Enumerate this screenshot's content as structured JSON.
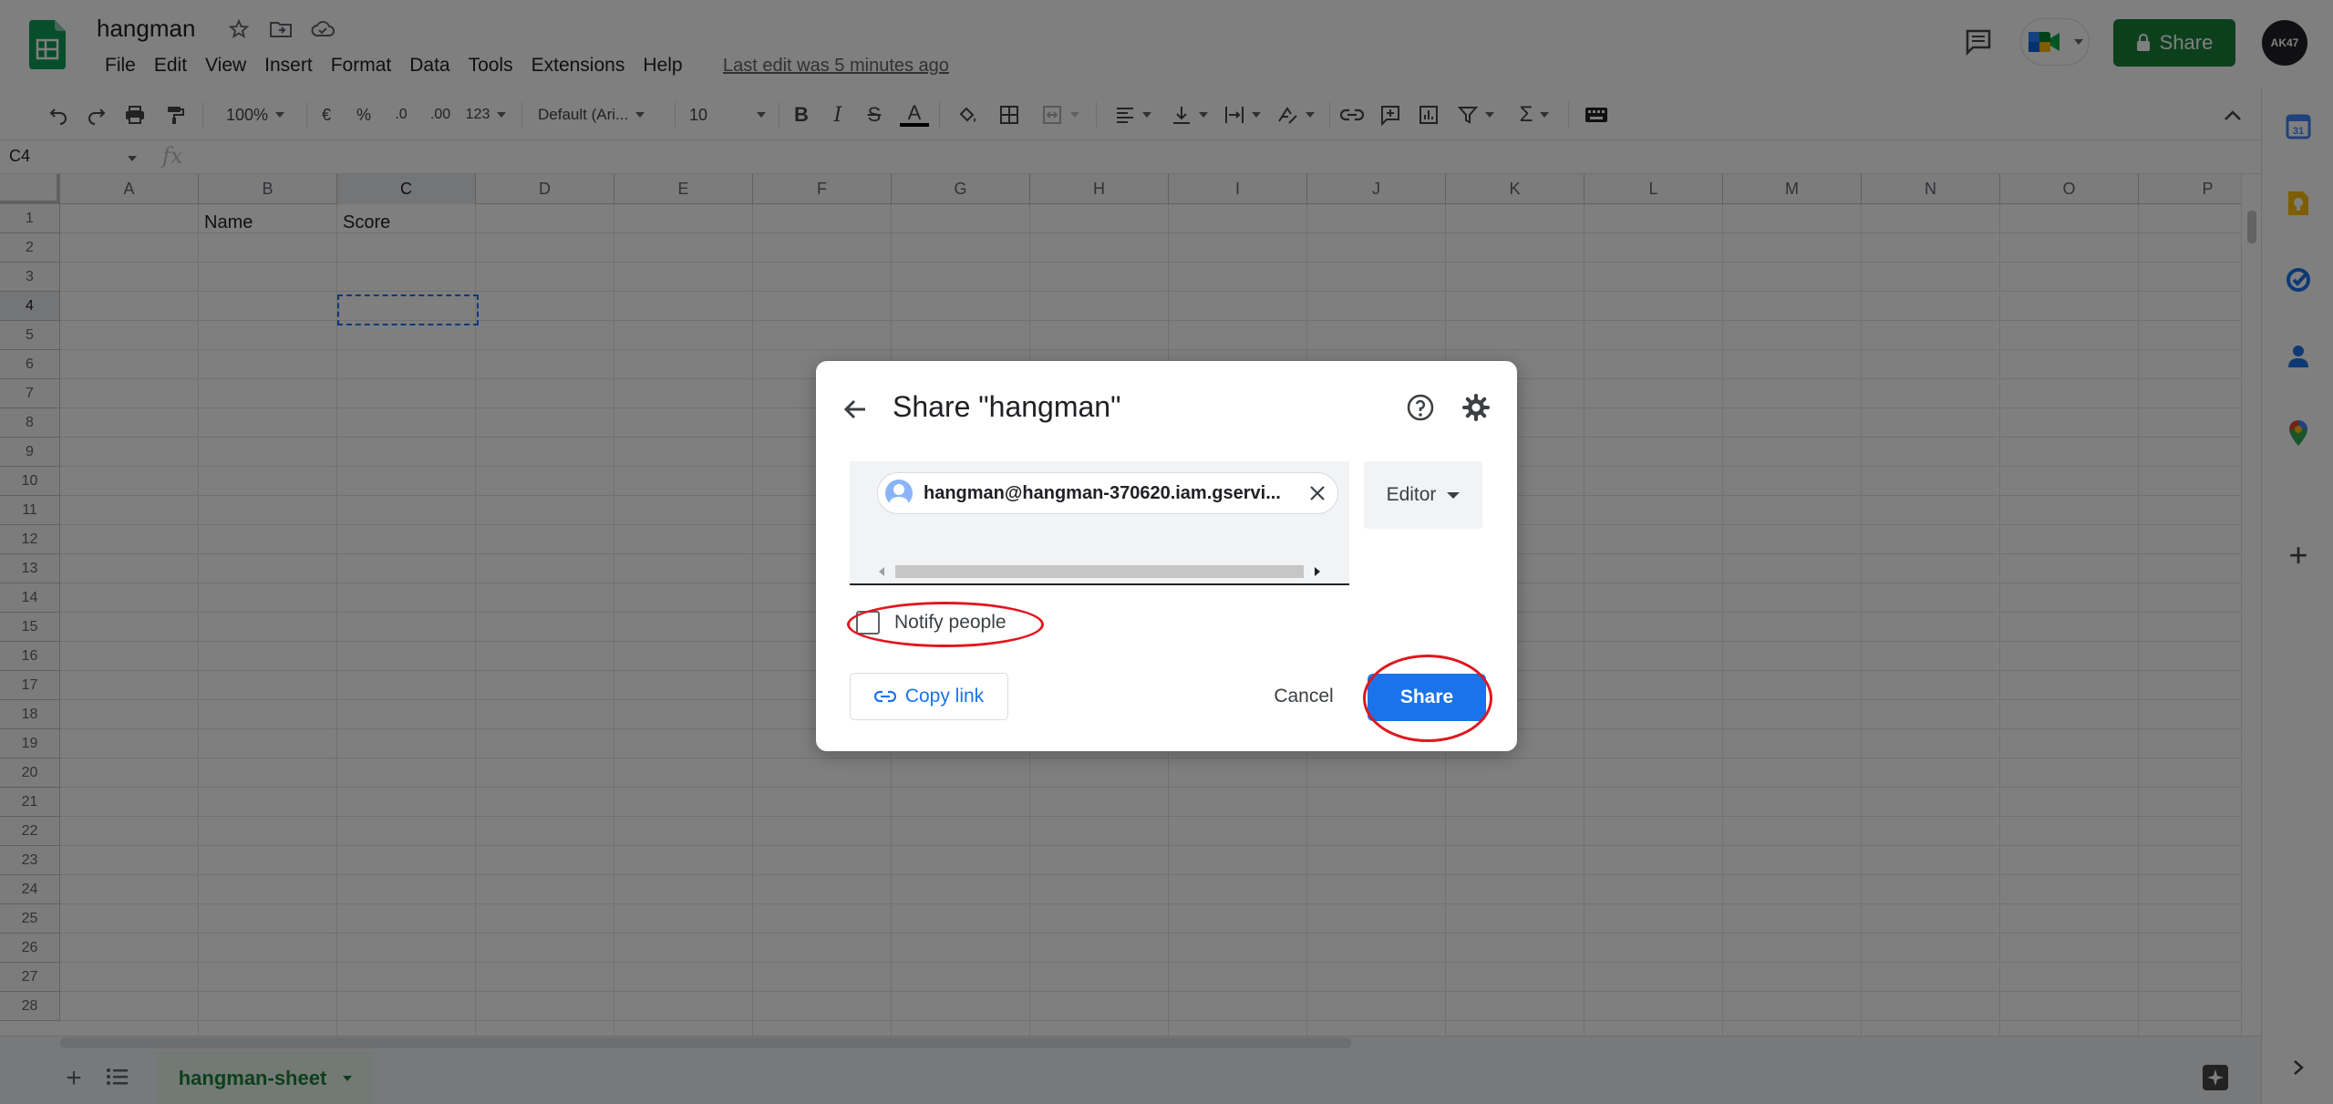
{
  "header": {
    "doc_title": "hangman",
    "menu": [
      "File",
      "Edit",
      "View",
      "Insert",
      "Format",
      "Data",
      "Tools",
      "Extensions",
      "Help"
    ],
    "last_edit": "Last edit was 5 minutes ago",
    "share_label": "Share",
    "avatar_text": "AK47"
  },
  "toolbar": {
    "zoom": "100%",
    "currency": "€",
    "percent": "%",
    "decrease_decimals": ".0",
    "increase_decimals": ".00",
    "more_formats": "123",
    "font": "Default (Ari...",
    "font_size": "10"
  },
  "formula_bar": {
    "cell_ref": "C4",
    "fx": "fx"
  },
  "grid": {
    "columns": [
      "A",
      "B",
      "C",
      "D",
      "E",
      "F",
      "G",
      "H",
      "I",
      "J",
      "K",
      "L",
      "M",
      "N",
      "O",
      "P"
    ],
    "rows": [
      "1",
      "2",
      "3",
      "4",
      "5",
      "6",
      "7",
      "8",
      "9",
      "10",
      "11",
      "12",
      "13",
      "14",
      "15",
      "16",
      "17",
      "18",
      "19",
      "20",
      "21",
      "22",
      "23",
      "24",
      "25",
      "26",
      "27",
      "28"
    ],
    "cells": {
      "B1": "Name",
      "C1": "Score"
    },
    "selected_column": "C",
    "selected_row": "4"
  },
  "sheets": {
    "active": "hangman-sheet"
  },
  "dialog": {
    "title": "Share \"hangman\"",
    "recipient": "hangman@hangman-370620.iam.gservi...",
    "role": "Editor",
    "notify_label": "Notify people",
    "notify_checked": false,
    "copy_link": "Copy link",
    "cancel": "Cancel",
    "share": "Share"
  },
  "colors": {
    "accent": "#1a73e8",
    "share_green": "#188038",
    "annotation_red": "#e0171f"
  }
}
